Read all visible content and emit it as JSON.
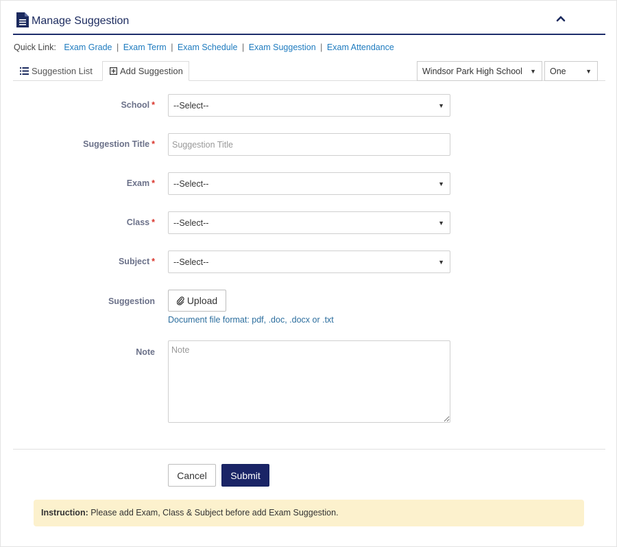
{
  "header": {
    "title": "Manage Suggestion",
    "icon": "document-icon",
    "collapse_icon": "chevron-up-icon",
    "accent_color": "#1d2d6b"
  },
  "quick_links": {
    "label": "Quick Link:",
    "links": [
      "Exam Grade",
      "Exam Term",
      "Exam Schedule",
      "Exam Suggestion",
      "Exam Attendance"
    ],
    "separator": "|"
  },
  "tabs": {
    "list_label": "Suggestion List",
    "add_label": "Add Suggestion"
  },
  "top_filters": {
    "school_value": "Windsor Park High School",
    "class_value": "One"
  },
  "form": {
    "required_mark": "*",
    "caret": "▼",
    "school": {
      "label": "School",
      "value": "--Select--"
    },
    "title": {
      "label": "Suggestion Title",
      "placeholder": "Suggestion Title"
    },
    "exam": {
      "label": "Exam",
      "value": "--Select--"
    },
    "class": {
      "label": "Class",
      "value": "--Select--"
    },
    "subject": {
      "label": "Subject",
      "value": "--Select--"
    },
    "suggestion": {
      "label": "Suggestion",
      "upload_label": "Upload",
      "hint": "Document file format: pdf, .doc, .docx or .txt"
    },
    "note": {
      "label": "Note",
      "placeholder": "Note"
    }
  },
  "actions": {
    "cancel_label": "Cancel",
    "submit_label": "Submit",
    "submit_color": "#1a2466"
  },
  "instruction": {
    "prefix": "Instruction:",
    "text": " Please add Exam, Class & Subject before add Exam Suggestion."
  }
}
